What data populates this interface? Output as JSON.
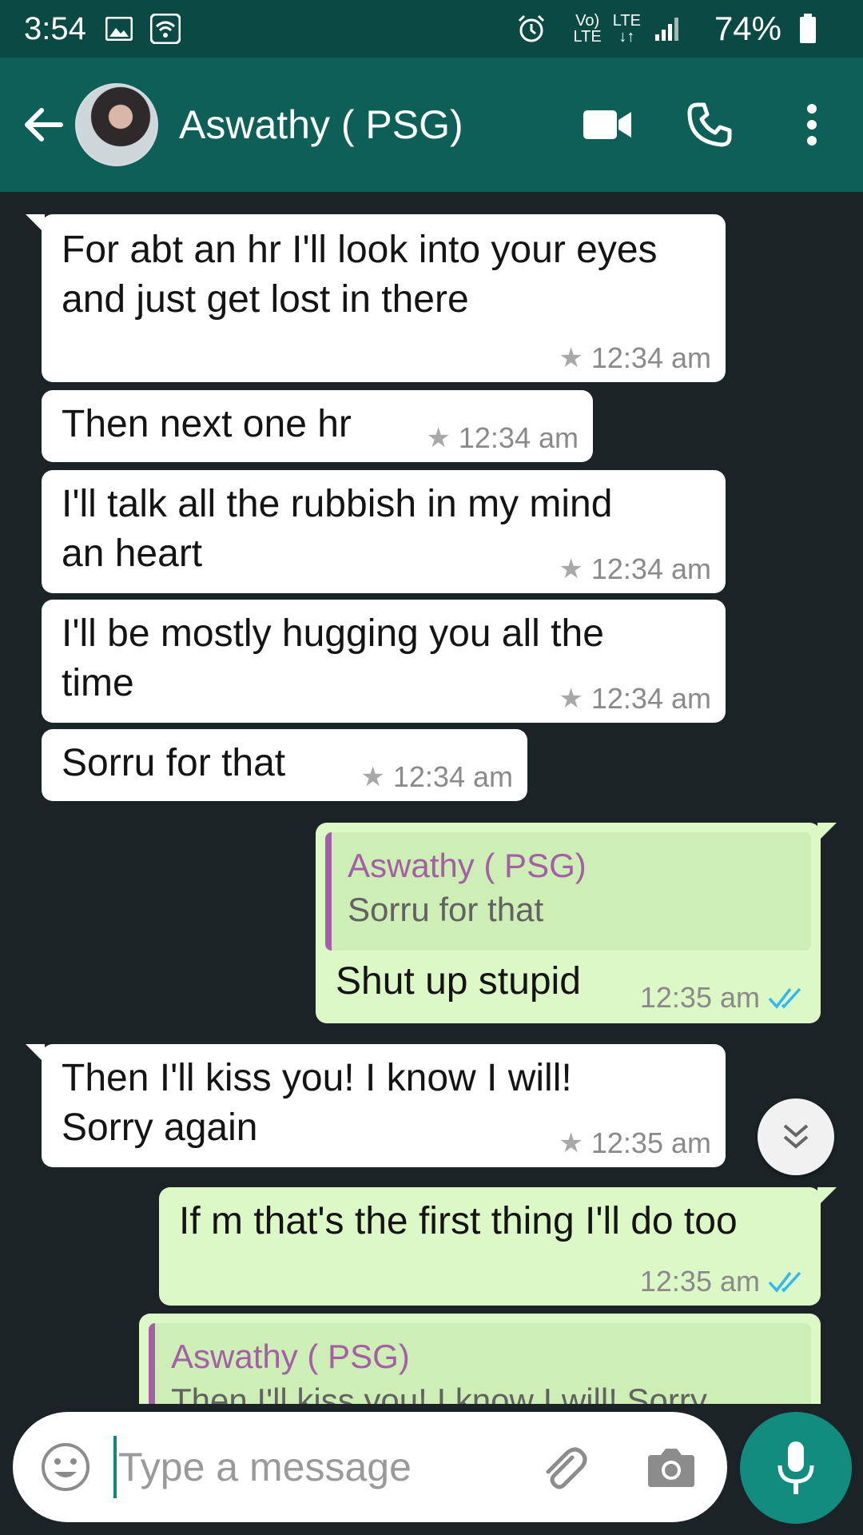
{
  "status_bar": {
    "time": "3:54",
    "volte_label_top": "Vo)",
    "volte_label_bottom": "LTE",
    "lte_label": "LTE",
    "battery": "74%"
  },
  "header": {
    "contact_name": "Aswathy ( PSG)"
  },
  "messages": [
    {
      "dir": "in",
      "text_lines": [
        "For abt an hr I'll look into your eyes",
        "and just get lost in there"
      ],
      "time": "12:34 am",
      "starred": true
    },
    {
      "dir": "in",
      "text_lines": [
        "Then next one hr"
      ],
      "time": "12:34 am",
      "starred": true
    },
    {
      "dir": "in",
      "text_lines": [
        "I'll talk all the rubbish in my mind",
        "an heart"
      ],
      "time": "12:34 am",
      "starred": true
    },
    {
      "dir": "in",
      "text_lines": [
        "I'll be mostly hugging you all the",
        "time"
      ],
      "time": "12:34 am",
      "starred": true
    },
    {
      "dir": "in",
      "text_lines": [
        "Sorru for that"
      ],
      "time": "12:34 am",
      "starred": true
    },
    {
      "dir": "out",
      "quote_name": "Aswathy ( PSG)",
      "quote_text": "Sorru for that",
      "text_lines": [
        "Shut up stupid"
      ],
      "time": "12:35 am",
      "read": true
    },
    {
      "dir": "in",
      "text_lines": [
        "Then I'll kiss you! I know I will!",
        "Sorry again"
      ],
      "time": "12:35 am",
      "starred": true
    },
    {
      "dir": "out",
      "text_lines": [
        "If m that's the first thing I'll do too"
      ],
      "time": "12:35 am",
      "read": true
    },
    {
      "dir": "out",
      "quote_name": "Aswathy ( PSG)",
      "quote_text": "Then I'll kiss you! I know I will! Sorry",
      "text_lines": []
    }
  ],
  "input": {
    "placeholder": "Type a message"
  },
  "icons": {
    "back": "arrow-left-icon",
    "video": "video-call-icon",
    "call": "phone-icon",
    "menu": "more-vert-icon",
    "emoji": "emoji-icon",
    "attach": "paperclip-icon",
    "camera": "camera-icon",
    "mic": "microphone-icon",
    "scroll_down": "double-chevron-down-icon"
  },
  "colors": {
    "header": "#0e5f58",
    "status_bar": "#0b4a44",
    "chat_background": "#1b2326",
    "incoming_bubble": "#ffffff",
    "outgoing_bubble": "#dcf8c6",
    "quote_accent": "#a55fa6",
    "read_ticks": "#34b7f1",
    "mic_button": "#128c7e"
  }
}
